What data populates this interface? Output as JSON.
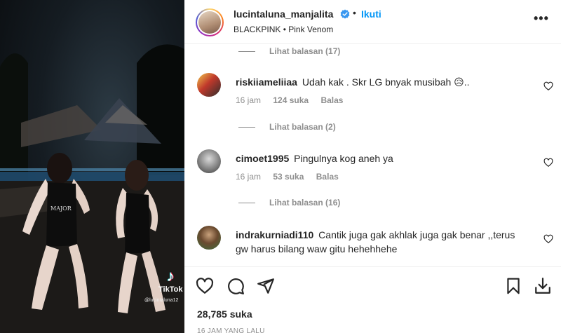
{
  "media": {
    "watermark_brand": "TikTok",
    "watermark_handle": "@lucintaluna12"
  },
  "post": {
    "username": "lucintaluna_manjalita",
    "separator": "•",
    "follow_label": "Ikuti",
    "audio": "BLACKPINK • Pink Venom",
    "more_label": "•••",
    "likes": "28,785 suka",
    "time_ago": "16 JAM YANG LALU"
  },
  "comments": [
    {
      "replies_label": "Lihat balasan (17)"
    },
    {
      "username": "riskiiameliiaa",
      "text": "Udah kak . Skr LG bnyak musibah 😥..",
      "time": "16 jam",
      "likes": "124 suka",
      "reply_label": "Balas",
      "replies_label": "Lihat balasan (2)"
    },
    {
      "username": "cimoet1995",
      "text": "Pingulnya kog aneh ya",
      "time": "16 jam",
      "likes": "53 suka",
      "reply_label": "Balas",
      "replies_label": "Lihat balasan (16)"
    },
    {
      "username": "indrakurniadi110",
      "text": "Cantik juga gak akhlak juga gak benar ,,terus gw harus bilang waw gitu hehehhehe"
    }
  ],
  "icons": {
    "like": "heart-icon",
    "comment": "comment-icon",
    "share": "share-icon",
    "save": "bookmark-icon",
    "download": "download-icon",
    "verified": "verified-badge-icon",
    "more": "more-options-icon"
  },
  "colors": {
    "follow_blue": "#0095f6",
    "text": "#262626",
    "muted": "#8e8e8e"
  }
}
